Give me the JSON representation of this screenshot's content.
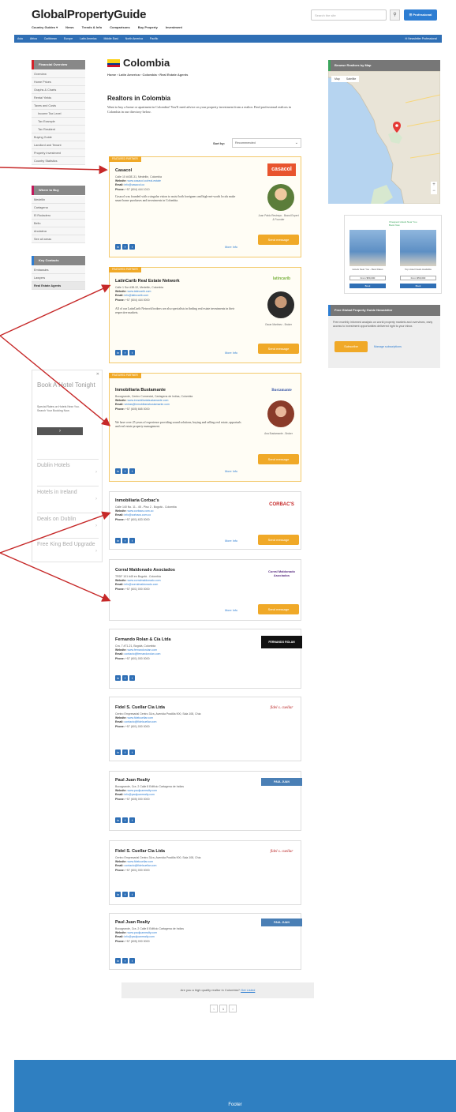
{
  "header": {
    "logo": "GlobalPropertyGuide",
    "nav": [
      "Country Guides ▾",
      "News",
      "Trends & Info",
      "Comparisons",
      "Buy Property",
      "Investment"
    ],
    "search_placeholder": "Search the site",
    "search_icon": "⚲",
    "pro_button": "☰ Professional",
    "regions": [
      "Asia",
      "Africa",
      "Caribbean",
      "Europe",
      "Latin America",
      "Middle East",
      "North America",
      "Pacific"
    ],
    "newsletter": "✉ Newsletter Professional"
  },
  "sidebar": {
    "groups": [
      {
        "heading": "Financial Overview",
        "items": [
          {
            "label": "Overview",
            "sub": false
          },
          {
            "label": "Home Prices",
            "sub": false
          },
          {
            "label": "Graphs & Charts",
            "sub": false
          },
          {
            "label": "Rental Yields",
            "sub": false
          },
          {
            "label": "Taxes and Costs",
            "sub": false
          },
          {
            "label": "Income Tax Level",
            "sub": true
          },
          {
            "label": "Tax Example",
            "sub": true
          },
          {
            "label": "Tax Resident",
            "sub": true
          },
          {
            "label": "Buying Guide",
            "sub": false
          },
          {
            "label": "Landlord and Tenant",
            "sub": false
          },
          {
            "label": "Property Investment",
            "sub": false
          },
          {
            "label": "Country Statistics",
            "sub": false
          }
        ]
      },
      {
        "heading": "Where to Buy",
        "items": [
          {
            "label": "Medellin",
            "sub": false
          },
          {
            "label": "Cartagena",
            "sub": false
          },
          {
            "label": "El Rodadero",
            "sub": false
          },
          {
            "label": "Bello",
            "sub": false
          },
          {
            "label": "Anolaima",
            "sub": false
          },
          {
            "label": "See all areas",
            "sub": false
          }
        ]
      },
      {
        "heading": "Key Contacts",
        "items": [
          {
            "label": "Embassies",
            "sub": false
          },
          {
            "label": "Lawyers",
            "sub": false
          },
          {
            "label": "Real Estate Agents",
            "sub": false,
            "active": true
          }
        ]
      }
    ]
  },
  "sidebar_ad": {
    "close": "✕",
    "title": "Book A Hotel Tonight",
    "small": "Special Rates on Hotels Near You. Search Your Booking Now.",
    "button": "›",
    "links": [
      "Dublin Hotels",
      "Hotels in Ireland",
      "Deals on Dublin",
      "Free King Bed Upgrade"
    ],
    "chev": "›"
  },
  "main": {
    "title": "Colombia",
    "breadcrumb": "Home  ›  Latin America  ›  Colombia  ›  Real Estate Agents",
    "section_title": "Realtors in Colombia",
    "intro": "Want to buy a home or apartment in Colombia? You'll need advice on your property investment from a realtor. Find professional realtors in Colombia in our directory below.",
    "sort_label": "Sort by:",
    "sort_value": "Recommended",
    "featured_tag": "FEATURED PARTNER",
    "more_info": "More Info",
    "send_message": "Send message",
    "social": [
      "in",
      "f",
      "t"
    ],
    "labels": {
      "website": "Website:",
      "email": "Email:",
      "phone": "Phone:"
    },
    "cards": [
      {
        "name": "Casacol",
        "address": "Calle 10 #43E-31, Medellín, Colombia",
        "website": "www.casacol.co/real-estate",
        "email": "info@casacol.co",
        "phone": "+57 (604) 444 1010",
        "desc": "Casacol was founded with a singular vision to assist both foreigners and high-net-worth locals make smart home purchases and investments in Colombia.",
        "logo": "casacol",
        "agent": "Juan Pablo Restrepo - Brand Expert & Founder"
      },
      {
        "name": "LatinCarib Real Estate Network",
        "address": "Calle 1 Sur #38-32, Medellín, Colombia",
        "website": "www.latincarib.com",
        "email": "info@latincarib.com",
        "phone": "+57 (604) 444 0000",
        "desc": "All of our LatinCarib Network brokers are also specialists in finding real estate investments in their respective markets.",
        "logo": "latincarib",
        "agent": "Oscar Martínez - Broker"
      },
      {
        "name": "Inmobiliaria Bustamante",
        "address": "Bocagrande, Centro Comercial, Cartagena de Indias, Colombia",
        "website": "www.inmobiliariabustamante.com",
        "email": "ventas@inmobiliariabustamante.com",
        "phone": "+57 (605) 665 0000",
        "desc": "We have over 25 years of experience providing sound solutions, buying and selling real estate, appraisals and real estate property management.",
        "logo": "Bustamante",
        "agent": "Ana Bustamante - Broker"
      },
      {
        "name": "Inmobiliaria Corbac's",
        "address": "Calle 140 No. 11 - 45 - Piso 2 - Bogotá - Colombia",
        "website": "www.corbacs.com.co",
        "email": "info@corbacs.com.co",
        "phone": "+57 (601) 633 0000",
        "logo": "CORBAC'S"
      },
      {
        "name": "Corral Maldonado Asociados",
        "address": "TRDF 101 #45 en Bogotá - Colombia",
        "website": "www.corralmaldonado.com",
        "email": "info@corralmaldonado.com",
        "phone": "+57 (601) 000 0000",
        "logo": "Corral Maldonado Asociados"
      },
      {
        "name": "Fernando Rolan & Cía Ltda",
        "address": "Cra. 7 #71-21, Bogotá, Colombia",
        "website": "www.fernandorolan.com",
        "email": "contacto@fernandorolan.com",
        "phone": "+57 (601) 000 0000",
        "logo": "FERNANDO ROLAN"
      },
      {
        "name": "Fidel S. Cuellar Cia Ltda",
        "address": "Centro Empresarial Centro 31ra, Avenida Pradilla 900, Sala 108, Chía",
        "website": "www.fidelcuellar.com",
        "email": "contacto@fidelcuellar.com",
        "phone": "+57 (601) 000 0000",
        "logo": "fidel s. cuellar"
      },
      {
        "name": "Paul Juan Realty",
        "address": "Bocagrande, Cra. 2 Calle 8 Edificio Cartagena de Indias",
        "website": "www.pauljuanrealty.com",
        "email": "info@pauljuanrealty.com",
        "phone": "+57 (605) 000 0000",
        "logo": "PAUL JUAN"
      },
      {
        "name": "Fidel S. Cuellar Cia Ltda",
        "address": "Centro Empresarial Centro 31ra, Avenida Pradilla 900, Sala 108, Chía",
        "website": "www.fidelcuellar.com",
        "email": "contacto@fidelcuellar.com",
        "phone": "+57 (601) 000 0000",
        "logo": "fidel s. cuellar"
      },
      {
        "name": "Paul Juan Realty",
        "address": "Bocagrande, Cra. 2 Calle 8 Edificio Cartagena de Indias",
        "website": "www.pauljuanrealty.com",
        "email": "info@pauljuanrealty.com",
        "phone": "+57 (605) 000 0000",
        "logo": "PAUL JUAN"
      }
    ],
    "prompt": "Are you a high quality realtor in Colombia?",
    "prompt_link": "Get Listed",
    "pager": [
      "‹",
      "1",
      "›"
    ]
  },
  "right": {
    "map_heading": "Browse Realtors by Map",
    "map_types": [
      "Map",
      "Satellite"
    ],
    "zoom": [
      "+",
      "−"
    ],
    "ad": {
      "headline": "Cheapest Hotels Near You. Book Now",
      "items": [
        {
          "text": "Hotels Near You - Best Rates",
          "price": "From $59,000",
          "go": "Book"
        },
        {
          "text": "Top Hotel Deals Available",
          "price": "From $59,000",
          "go": "Book"
        }
      ]
    },
    "newsletter_heading": "Free Global Property Guide Newsletter",
    "newsletter_text": "Free monthly informed analysis on world property markets and overviews, early access to investment opportunities delivered right to your inbox.",
    "newsletter_button": "Subscribe",
    "newsletter_link": "Manage subscriptions"
  },
  "footer": {
    "text": "Footer"
  },
  "colors": {
    "accent": "#f0a928",
    "brand_blue": "#2f6fb5",
    "annotation": "#c62828"
  }
}
